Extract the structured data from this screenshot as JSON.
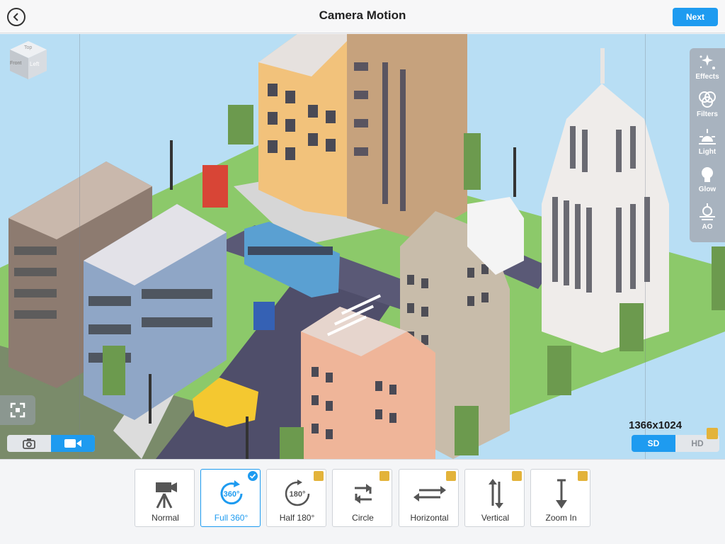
{
  "header": {
    "title": "Camera Motion",
    "next_label": "Next"
  },
  "view_cube": {
    "top_label": "Top",
    "front_label": "Front",
    "left_label": "Left"
  },
  "tools": [
    {
      "label": "Effects",
      "icon": "sparkles-icon"
    },
    {
      "label": "Filters",
      "icon": "filters-icon"
    },
    {
      "label": "Light",
      "icon": "sunrise-icon"
    },
    {
      "label": "Glow",
      "icon": "lightbulb-icon"
    },
    {
      "label": "AO",
      "icon": "sun-haze-icon"
    }
  ],
  "capture_mode": {
    "options": [
      "photo",
      "video"
    ],
    "selected": "video"
  },
  "output": {
    "resolution": "1366x1024",
    "quality_options": [
      "SD",
      "HD"
    ],
    "selected_quality": "SD"
  },
  "motions": [
    {
      "label": "Normal",
      "icon": "tripod-camera-icon",
      "premium": false,
      "selected": false
    },
    {
      "label": "Full 360°",
      "icon": "rotate-360-icon",
      "icon_text": "360°",
      "premium": false,
      "selected": true
    },
    {
      "label": "Half 180°",
      "icon": "rotate-180-icon",
      "icon_text": "180°",
      "premium": true,
      "selected": false
    },
    {
      "label": "Circle",
      "icon": "circle-arrows-icon",
      "premium": true,
      "selected": false
    },
    {
      "label": "Horizontal",
      "icon": "horizontal-arrows-icon",
      "premium": true,
      "selected": false
    },
    {
      "label": "Vertical",
      "icon": "vertical-arrows-icon",
      "premium": true,
      "selected": false
    },
    {
      "label": "Zoom In",
      "icon": "zoom-in-arrow-icon",
      "premium": true,
      "selected": false
    }
  ],
  "colors": {
    "accent": "#1e9bf0",
    "premium": "#e3b33a",
    "sky": "#b8def4",
    "panel": "#a8b3bf"
  }
}
